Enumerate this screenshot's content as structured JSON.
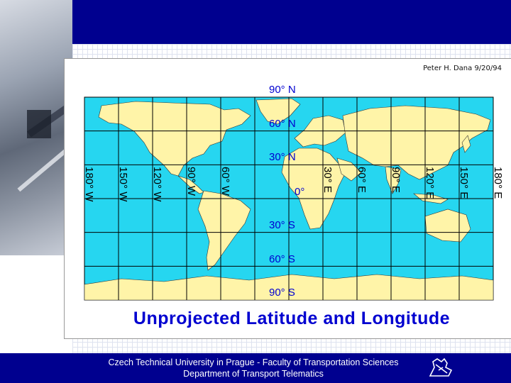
{
  "credit": "Peter H. Dana 9/20/94",
  "map": {
    "title": "Unprojected Latitude and Longitude",
    "latitude_labels": [
      "90° N",
      "60° N",
      "30° N",
      "0°",
      "30° S",
      "60° S",
      "90° S"
    ],
    "longitude_labels": [
      "180° W",
      "150° W",
      "120° W",
      "90° W",
      "60° W",
      "30° E",
      "60° E",
      "90° E",
      "120° E",
      "150° E",
      "180° E"
    ],
    "ocean_color": "#26d6f0",
    "land_color": "#fff4a8",
    "grid_color": "#000000"
  },
  "footer": {
    "line1": "Czech Technical University in Prague - Faculty of Transportation Sciences",
    "line2": "Department of Transport Telematics",
    "logo_icon": "lion-emblem-icon"
  },
  "colors": {
    "band": "#00008f",
    "title": "#0000d0"
  }
}
